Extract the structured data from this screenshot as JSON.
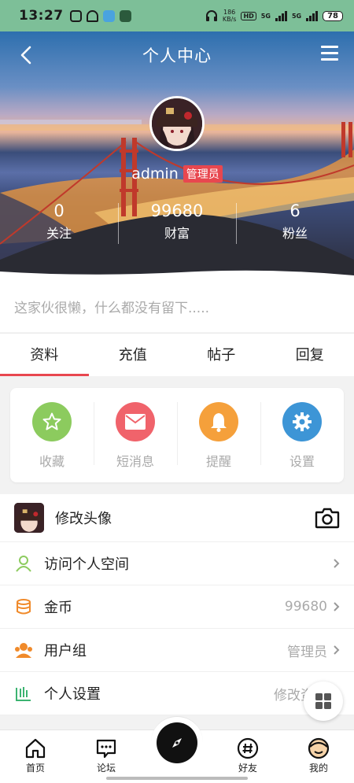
{
  "status_bar": {
    "time": "13:27",
    "net_speed_value": "186",
    "net_speed_unit": "KB/s",
    "hd_label": "HD",
    "signal1_label": "5G",
    "signal2_label": "5G",
    "battery": "78"
  },
  "header": {
    "title": "个人中心"
  },
  "profile": {
    "username": "admin",
    "role_badge": "管理员",
    "bio": "这家伙很懒，什么都没有留下.....",
    "stats": [
      {
        "value": "0",
        "label": "关注"
      },
      {
        "value": "99680",
        "label": "财富"
      },
      {
        "value": "6",
        "label": "粉丝"
      }
    ]
  },
  "tabs": [
    {
      "label": "资料",
      "active": true
    },
    {
      "label": "充值",
      "active": false
    },
    {
      "label": "帖子",
      "active": false
    },
    {
      "label": "回复",
      "active": false
    }
  ],
  "quick_actions": [
    {
      "label": "收藏",
      "icon": "star-icon",
      "color": "#8ccb5e"
    },
    {
      "label": "短消息",
      "icon": "mail-icon",
      "color": "#f0636b"
    },
    {
      "label": "提醒",
      "icon": "bell-icon",
      "color": "#f5a03b"
    },
    {
      "label": "设置",
      "icon": "gear-icon",
      "color": "#3d95d6"
    }
  ],
  "menu": {
    "change_avatar": "修改头像",
    "rows": [
      {
        "label": "访问个人空间",
        "value": "",
        "icon": "user-icon"
      },
      {
        "label": "金币",
        "value": "99680",
        "icon": "coins-icon"
      },
      {
        "label": "用户组",
        "value": "管理员",
        "icon": "group-icon"
      },
      {
        "label": "个人设置",
        "value": "修改资料",
        "icon": "settings-icon"
      }
    ]
  },
  "bottom_nav": [
    {
      "label": "首页",
      "icon": "home-icon"
    },
    {
      "label": "论坛",
      "icon": "forum-icon"
    },
    {
      "label": "好友",
      "icon": "hashtag-icon"
    },
    {
      "label": "我的",
      "icon": "profile-face-icon"
    }
  ],
  "colors": {
    "status_bar": "#7dbf98",
    "accent": "#e8474f"
  }
}
